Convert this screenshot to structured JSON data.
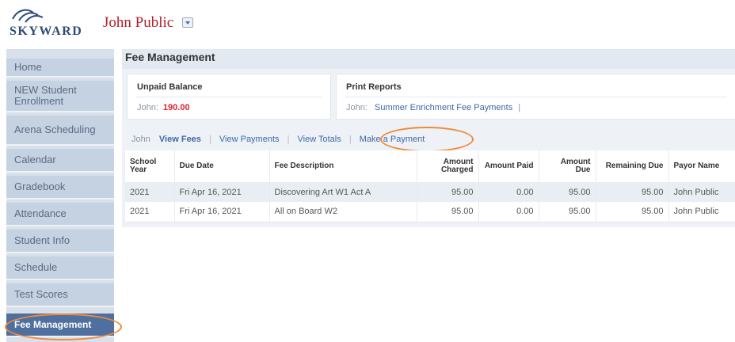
{
  "header": {
    "logo_text": "SKYWARD",
    "user_name": "John Public"
  },
  "sidebar": {
    "items": [
      {
        "label": "Home",
        "active": false
      },
      {
        "label": "NEW Student Enrollment",
        "active": false
      },
      {
        "label": "Arena Scheduling",
        "active": false
      },
      {
        "label": "Calendar",
        "active": false
      },
      {
        "label": "Gradebook",
        "active": false
      },
      {
        "label": "Attendance",
        "active": false
      },
      {
        "label": "Student Info",
        "active": false
      },
      {
        "label": "Schedule",
        "active": false
      },
      {
        "label": "Test Scores",
        "active": false
      },
      {
        "label": "Fee Management",
        "active": true
      }
    ]
  },
  "main": {
    "title": "Fee Management",
    "unpaid_balance": {
      "title": "Unpaid Balance",
      "student": "John:",
      "amount": "190.00"
    },
    "print_reports": {
      "title": "Print Reports",
      "student": "John:",
      "link": "Summer Enrichment Fee Payments",
      "trailing_sep": "|"
    },
    "tabs": {
      "student": "John",
      "view_fees": "View Fees",
      "view_payments": "View Payments",
      "view_totals": "View Totals",
      "make_payment": "Make a Payment",
      "separator": "|"
    },
    "table": {
      "headers": [
        "School Year",
        "Due Date",
        "Fee Description",
        "Amount Charged",
        "Amount Paid",
        "Amount Due",
        "Remaining Due",
        "Payor Name"
      ],
      "rows": [
        [
          "2021",
          "Fri Apr 16, 2021",
          "Discovering Art W1 Act A",
          "95.00",
          "0.00",
          "95.00",
          "95.00",
          "John Public"
        ],
        [
          "2021",
          "Fri Apr 16, 2021",
          "All on Board W2",
          "95.00",
          "0.00",
          "95.00",
          "95.00",
          "John Public"
        ]
      ]
    }
  },
  "colors": {
    "brand_red": "#b3202a",
    "balance_red": "#e0232e",
    "link_blue": "#3f67a8",
    "sidebar_active": "#4f6f9e",
    "highlight_orange": "#ef8a3c"
  }
}
